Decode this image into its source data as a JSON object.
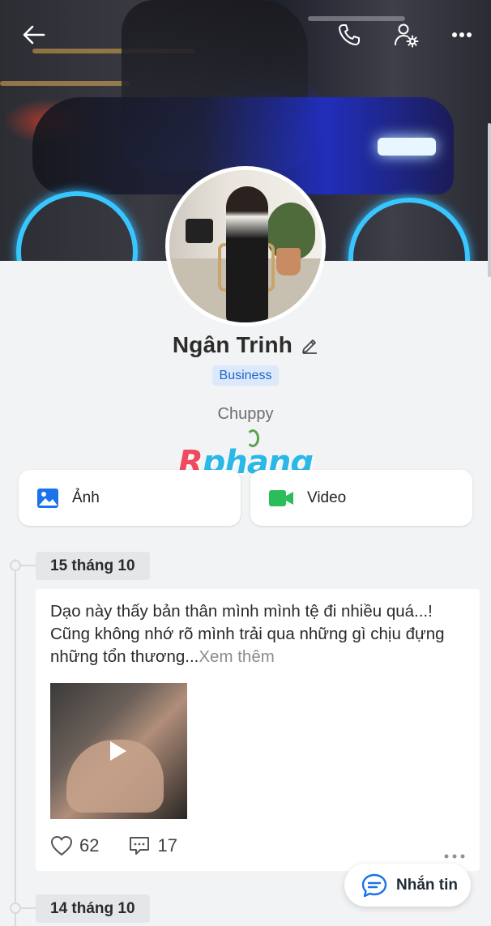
{
  "profile": {
    "name": "Ngân Trinh",
    "badge": "Business",
    "bio": "Chuppy"
  },
  "watermark": {
    "r": "R",
    "rest": "phang"
  },
  "media": {
    "photos_label": "Ảnh",
    "video_label": "Video"
  },
  "timeline": {
    "dates": [
      "15 tháng 10",
      "14 tháng 10"
    ]
  },
  "post": {
    "text": "Dạo này thấy bản thân mình mình tệ đi nhiều quá...! Cũng không nhớ rõ mình trải qua những gì chịu đựng những tổn thương...",
    "see_more": "Xem thêm",
    "likes": "62",
    "comments": "17"
  },
  "fab": {
    "label": "Nhắn tin"
  },
  "colors": {
    "accent": "#1e64c8",
    "video_green": "#2bbd5a",
    "photo_blue": "#1a73e8"
  },
  "icons": [
    "back-arrow-icon",
    "phone-icon",
    "profile-settings-icon",
    "more-horizontal-icon",
    "edit-pencil-icon",
    "image-icon",
    "video-camera-icon",
    "heart-icon",
    "comment-icon",
    "chat-bubble-icon",
    "play-icon"
  ]
}
